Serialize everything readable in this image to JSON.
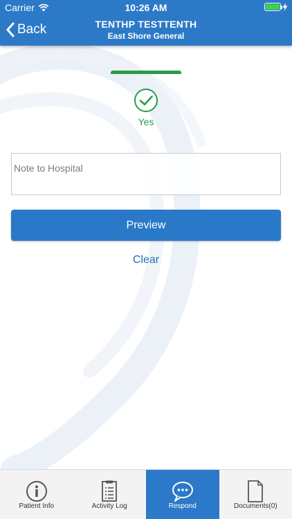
{
  "status_bar": {
    "carrier": "Carrier",
    "time": "10:26 AM"
  },
  "nav": {
    "back_label": "Back",
    "title": "TENTHP TESTTENTH",
    "subtitle": "East Shore General"
  },
  "response": {
    "selected_answer": "Yes",
    "note_placeholder": "Note to Hospital",
    "note_value": "",
    "preview_label": "Preview",
    "clear_label": "Clear"
  },
  "tabs": [
    {
      "label": "Patient Info",
      "icon": "info-icon",
      "active": false
    },
    {
      "label": "Activity Log",
      "icon": "activity-log-icon",
      "active": false
    },
    {
      "label": "Respond",
      "icon": "chat-bubble-icon",
      "active": true
    },
    {
      "label": "Documents(0)",
      "icon": "document-icon",
      "active": false
    }
  ],
  "colors": {
    "header": "#2c7ac7",
    "success": "#2a9a4a",
    "button": "#2a78c8",
    "link": "#1f6fb6",
    "tab_active": "#2b79c8"
  }
}
